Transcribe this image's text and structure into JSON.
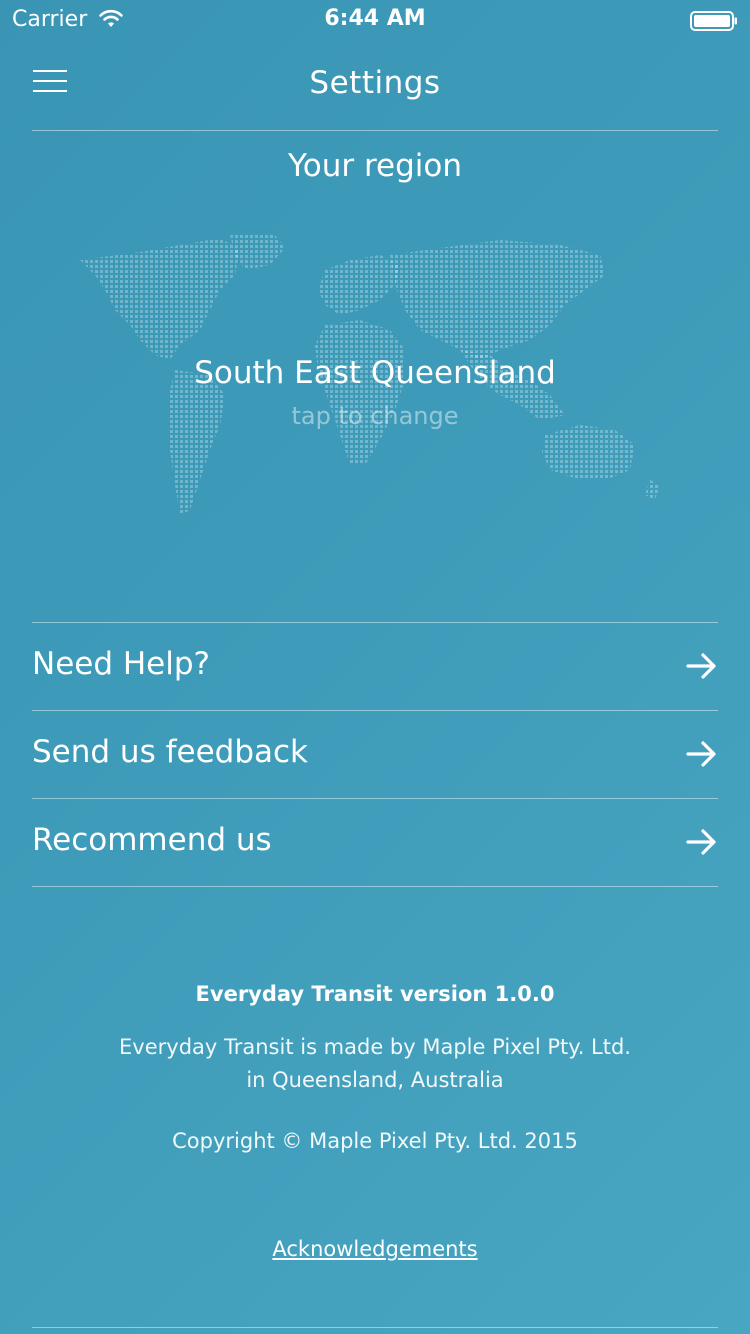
{
  "status_bar": {
    "carrier": "Carrier",
    "time": "6:44 AM",
    "wifi_icon": "wifi-icon",
    "battery_icon": "battery-icon"
  },
  "header": {
    "title": "Settings",
    "menu_icon": "hamburger-menu-icon"
  },
  "region": {
    "heading": "Your region",
    "name": "South East Queensland",
    "hint": "tap to change",
    "map_icon": "world-map-icon"
  },
  "menu": {
    "items": [
      {
        "label": "Need Help?",
        "icon": "arrow-right-icon"
      },
      {
        "label": "Send us feedback",
        "icon": "arrow-right-icon"
      },
      {
        "label": "Recommend us",
        "icon": "arrow-right-icon"
      }
    ]
  },
  "footer": {
    "version": "Everyday Transit version 1.0.0",
    "made_by_line1": "Everyday Transit is made by Maple Pixel Pty. Ltd.",
    "made_by_line2": "in Queensland, Australia",
    "copyright": "Copyright © Maple Pixel Pty. Ltd. 2015",
    "acknowledgements": "Acknowledgements"
  },
  "colors": {
    "background_start": "#3a95b4",
    "background_end": "#48a6c2",
    "text": "#ffffff"
  }
}
